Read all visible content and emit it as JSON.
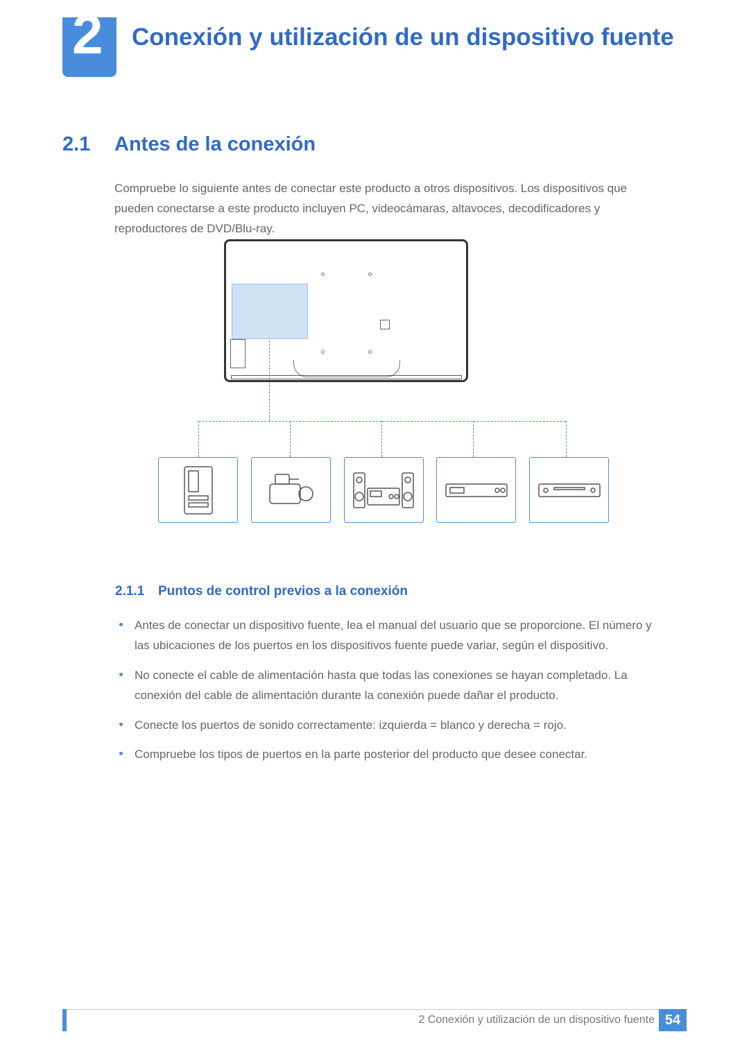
{
  "chapter": {
    "number": "2",
    "title": "Conexión y utilización de un dispositivo fuente"
  },
  "section": {
    "number": "2.1",
    "title": "Antes de la conexión"
  },
  "intro": "Compruebe lo siguiente antes de conectar este producto a otros dispositivos. Los dispositivos que pueden conectarse a este producto incluyen PC, videocámaras, altavoces, decodificadores y reproductores de DVD/Blu-ray.",
  "subsection": {
    "number": "2.1.1",
    "title": "Puntos de control previos a la conexión"
  },
  "bullets": [
    "Antes de conectar un dispositivo fuente, lea el manual del usuario que se proporcione. El número y las ubicaciones de los puertos en los dispositivos fuente puede variar, según el dispositivo.",
    "No conecte el cable de alimentación hasta que todas las conexiones se hayan completado. La conexión del cable de alimentación durante la conexión puede dañar el producto.",
    "Conecte los puertos de sonido correctamente: izquierda = blanco y derecha = rojo.",
    "Compruebe los tipos de puertos en la parte posterior del producto que desee conectar."
  ],
  "devices": [
    "pc",
    "camcorder",
    "speakers",
    "set-top-box",
    "dvd-player"
  ],
  "footer": {
    "text": "2 Conexión y utilización de un dispositivo fuente",
    "page": "54"
  }
}
